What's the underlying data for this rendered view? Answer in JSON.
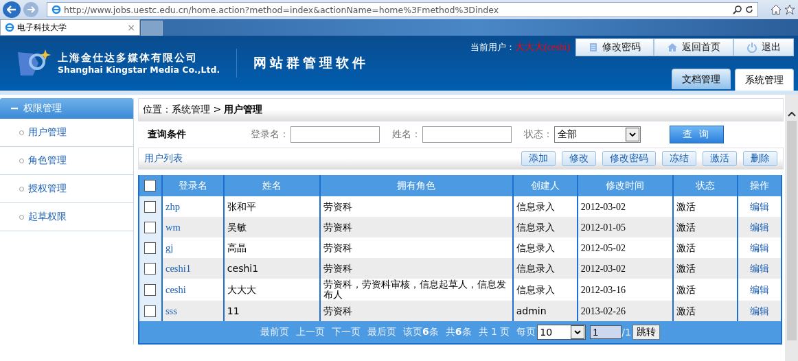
{
  "browser": {
    "url": "http://www.jobs.uestc.edu.cn/home.action?method=index&actionName=home%3Fmethod%3Dindex",
    "tab_title": "电子科技大学",
    "tab_close": "×"
  },
  "header": {
    "company_cn": "上海金仕达多媒体有限公司",
    "company_en": "Shanghai Kingstar Media Co.,Ltd.",
    "product": "网站群管理软件",
    "user_label": "当前用户：",
    "user_name": "大大大(ceshi)",
    "actions": [
      {
        "label": "修改密码",
        "kind": "doc"
      },
      {
        "label": "返回首页",
        "kind": "home"
      },
      {
        "label": "退出",
        "kind": "power"
      }
    ],
    "tabs": [
      {
        "label": "文档管理",
        "selected": false
      },
      {
        "label": "系统管理",
        "selected": true
      }
    ]
  },
  "sidebar": {
    "title": "权限管理",
    "expanded": true,
    "items": [
      {
        "label": "用户管理"
      },
      {
        "label": "角色管理"
      },
      {
        "label": "授权管理"
      },
      {
        "label": "起草权限"
      }
    ]
  },
  "breadcrumb": {
    "prefix": "位置：系统管理 >",
    "current": "用户管理"
  },
  "query": {
    "title": "查询条件",
    "login_label": "登录名：",
    "name_label": "姓名：",
    "status_label": "状态：",
    "status_value": "全部",
    "button": "查 询"
  },
  "list": {
    "title": "用户列表",
    "buttons": [
      "添加",
      "修改",
      "修改密码",
      "冻结",
      "激活",
      "删除"
    ]
  },
  "table": {
    "columns": [
      "登录名",
      "姓名",
      "拥有角色",
      "创建人",
      "修改时间",
      "状态",
      "操作"
    ],
    "header_checked": false,
    "rows": [
      {
        "checked": false,
        "login": "zhp",
        "name": "张和平",
        "roles": "劳资科",
        "creator": "信息录入",
        "time": "2012-03-02",
        "status": "激活",
        "action": "编辑"
      },
      {
        "checked": false,
        "login": "wm",
        "name": "吴敏",
        "roles": "劳资科",
        "creator": "信息录入",
        "time": "2012-01-05",
        "status": "激活",
        "action": "编辑"
      },
      {
        "checked": false,
        "login": "gj",
        "name": "高晶",
        "roles": "劳资科",
        "creator": "信息录入",
        "time": "2012-05-02",
        "status": "激活",
        "action": "编辑"
      },
      {
        "checked": false,
        "login": "ceshi1",
        "name": "ceshi1",
        "roles": "劳资科",
        "creator": "信息录入",
        "time": "2012-03-02",
        "status": "激活",
        "action": "编辑"
      },
      {
        "checked": false,
        "login": "ceshi",
        "name": "大大大",
        "roles": "劳资科，劳资科审核，信息起草人，信息发布人",
        "creator": "信息录入",
        "time": "2012-03-16",
        "status": "激活",
        "action": "编辑"
      },
      {
        "checked": false,
        "login": "sss",
        "name": "11",
        "roles": "劳资科",
        "creator": "admin",
        "time": "2013-02-26",
        "status": "激活",
        "action": "编辑"
      }
    ]
  },
  "pager": {
    "links": [
      "最前页",
      "上一页",
      "下一页",
      "最后页"
    ],
    "info": [
      "该页**6**条",
      "共**6**条",
      "共 1 页"
    ],
    "per_page_label": "每页",
    "per_page": "10",
    "page": "1",
    "total": "/1",
    "go": "跳转"
  }
}
